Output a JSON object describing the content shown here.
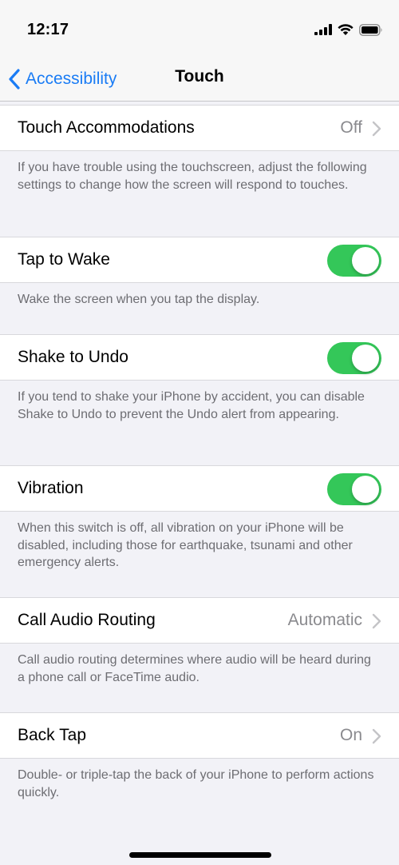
{
  "status_bar": {
    "time": "12:17"
  },
  "nav": {
    "back_label": "Accessibility",
    "title": "Touch"
  },
  "rows": {
    "touch_accommodations": {
      "label": "Touch Accommodations",
      "value": "Off",
      "footer": "If you have trouble using the touchscreen, adjust the following settings to change how the screen will respond to touches."
    },
    "tap_to_wake": {
      "label": "Tap to Wake",
      "enabled": true,
      "footer": "Wake the screen when you tap the display."
    },
    "shake_to_undo": {
      "label": "Shake to Undo",
      "enabled": true,
      "footer": "If you tend to shake your iPhone by accident, you can disable Shake to Undo to prevent the Undo alert from appearing."
    },
    "vibration": {
      "label": "Vibration",
      "enabled": true,
      "footer": "When this switch is off, all vibration on your iPhone will be disabled, including those for earthquake, tsunami and other emergency alerts."
    },
    "call_audio_routing": {
      "label": "Call Audio Routing",
      "value": "Automatic",
      "footer": "Call audio routing determines where audio will be heard during a phone call or FaceTime audio."
    },
    "back_tap": {
      "label": "Back Tap",
      "value": "On",
      "footer": "Double- or triple-tap the back of your iPhone to perform actions quickly."
    }
  },
  "colors": {
    "accent": "#1a7cf5",
    "toggle_on": "#34c759",
    "secondary_text": "#8a8a8e",
    "background": "#f2f2f7"
  },
  "icons": [
    "cellular-signal-icon",
    "wifi-icon",
    "battery-icon",
    "back-chevron-icon",
    "chevron-right-icon"
  ]
}
